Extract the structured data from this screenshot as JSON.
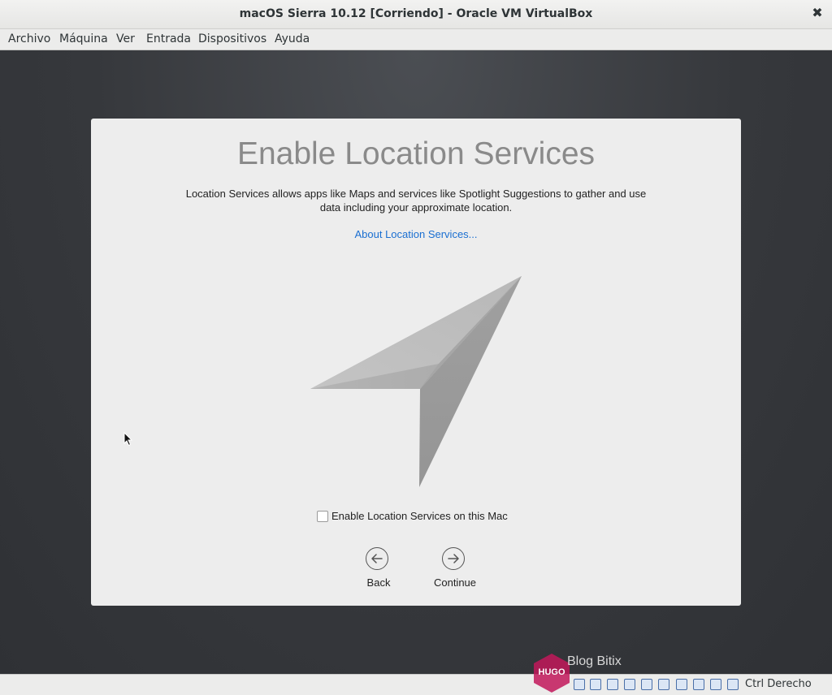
{
  "window": {
    "title": "macOS Sierra 10.12 [Corriendo] - Oracle VM VirtualBox",
    "close_glyph": "✖"
  },
  "menu": [
    "Archivo",
    "Máquina",
    "Ver",
    "Entrada",
    "Dispositivos",
    "Ayuda"
  ],
  "setup": {
    "heading": "Enable Location Services",
    "description_line1": "Location Services allows apps like Maps and services like Spotlight Suggestions to gather and use",
    "description_line2": "data including your approximate location.",
    "about_link": "About Location Services...",
    "checkbox_label": "Enable Location Services on this Mac",
    "checkbox_checked": false,
    "back_label": "Back",
    "continue_label": "Continue",
    "illustration_icon": "location-arrow-icon"
  },
  "statusbar": {
    "host_key": "Ctrl Derecho",
    "icons": [
      "hard-disk-icon",
      "optical-drive-icon",
      "audio-icon",
      "network-icon",
      "usb-icon",
      "shared-folder-icon",
      "display-icon",
      "recording-icon",
      "cpu-icon",
      "mouse-integration-icon"
    ]
  },
  "watermark": {
    "badge": "HUGO",
    "text": "Blog Bitix"
  },
  "colors": {
    "link": "#1a6fd1",
    "heading": "#8a8a8a",
    "card": "#ededed",
    "desktop": "#36383c",
    "watermark_badge": "#c2185b"
  }
}
